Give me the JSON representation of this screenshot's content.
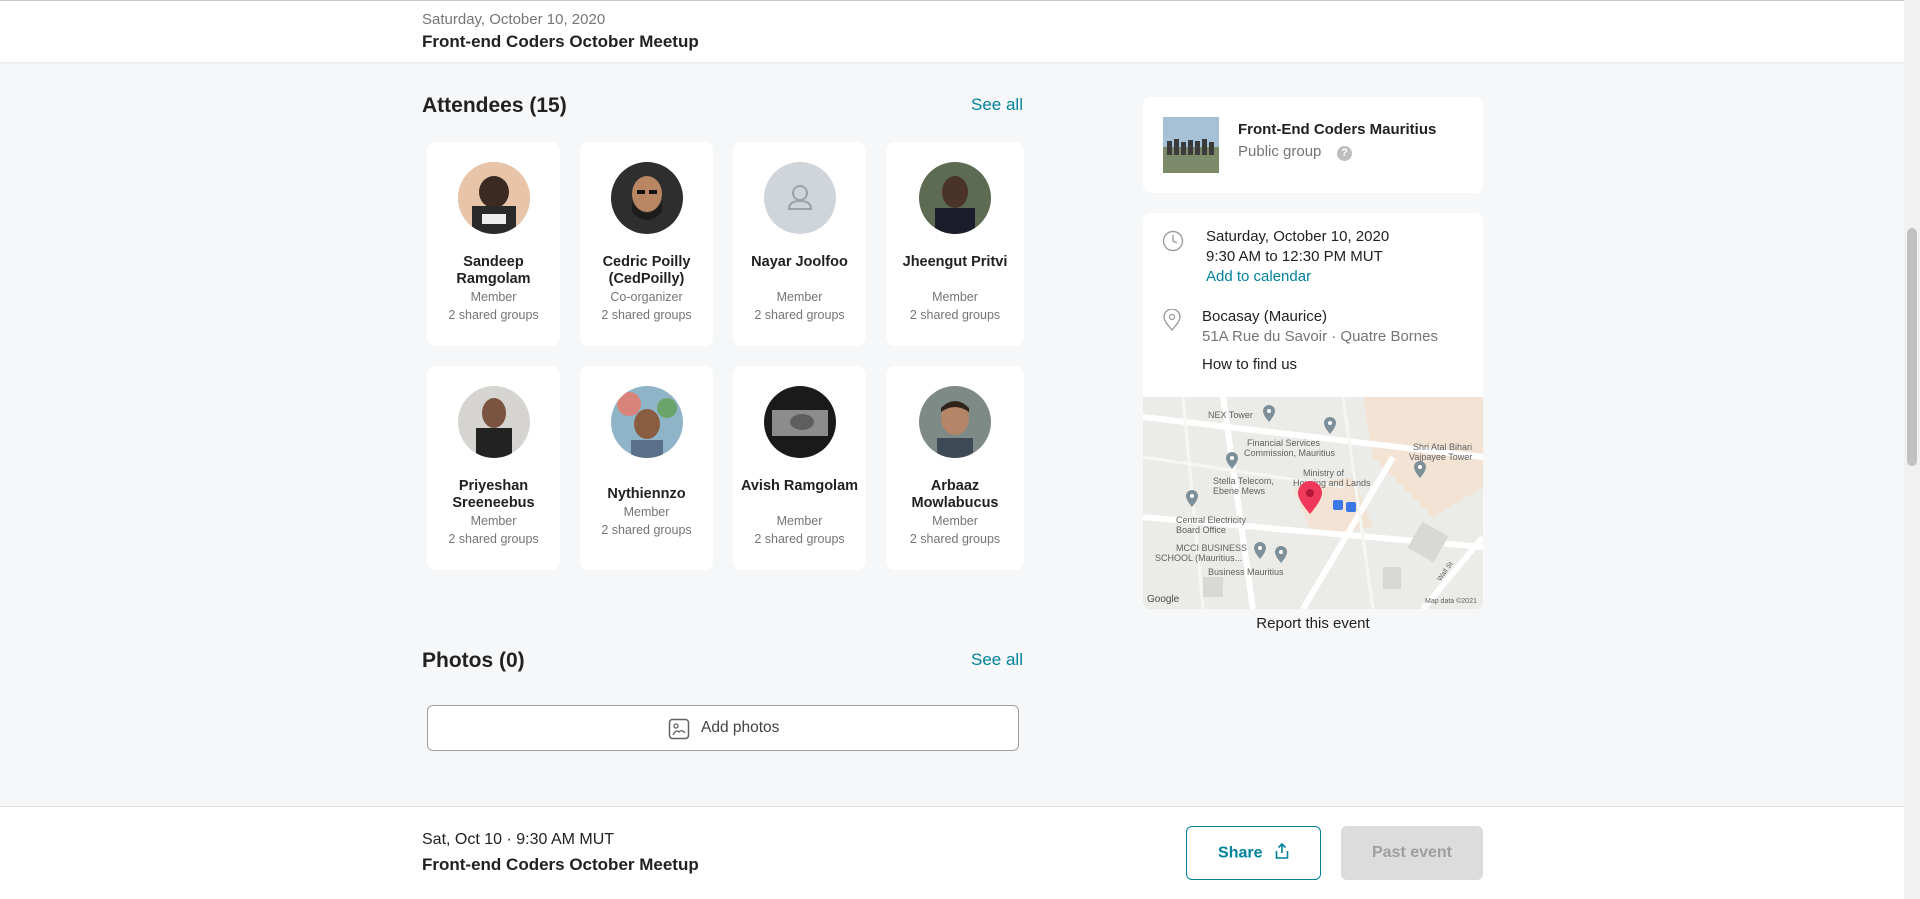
{
  "header": {
    "date": "Saturday, October 10, 2020",
    "title": "Front-end Coders October Meetup"
  },
  "attendees": {
    "title": "Attendees (15)",
    "see_all": "See all",
    "people": [
      {
        "name": "Sandeep Ramgolam",
        "role": "Member",
        "shared": "2 shared groups"
      },
      {
        "name": "Cedric Poilly (CedPoilly)",
        "role": "Co-organizer",
        "shared": "2 shared groups"
      },
      {
        "name": "Nayar Joolfoo",
        "role": "Member",
        "shared": "2 shared groups"
      },
      {
        "name": "Jheengut Pritvi",
        "role": "Member",
        "shared": "2 shared groups"
      },
      {
        "name": "Priyeshan Sreeneebus",
        "role": "Member",
        "shared": "2 shared groups"
      },
      {
        "name": "Nythiennzo",
        "role": "Member",
        "shared": "2 shared groups"
      },
      {
        "name": "Avish Ramgolam",
        "role": "Member",
        "shared": "2 shared groups"
      },
      {
        "name": "Arbaaz Mowlabucus",
        "role": "Member",
        "shared": "2 shared groups"
      }
    ]
  },
  "photos": {
    "title": "Photos (0)",
    "see_all": "See all",
    "add_label": "Add photos"
  },
  "group": {
    "name": "Front-End Coders Mauritius",
    "type": "Public group",
    "help": "?"
  },
  "event_info": {
    "date": "Saturday, October 10, 2020",
    "time": "9:30 AM to 12:30 PM MUT",
    "add_calendar": "Add to calendar",
    "venue": "Bocasay (Maurice)",
    "address": "51A Rue du Savoir · Quatre Bornes",
    "how_to_find": "How to find us"
  },
  "map": {
    "labels": {
      "nex": "NEX Tower",
      "fsc1": "Financial Services",
      "fsc2": "Commission, Mauritius",
      "shri1": "Shri Atal Bihari",
      "shri2": "Vajpayee Tower",
      "min1": "Ministry of",
      "min2": "Housing and Lands",
      "stella1": "Stella Telecom,",
      "stella2": "Ebene Mews",
      "ceb1": "Central Electricity",
      "ceb2": "Board Office",
      "mcci1": "MCCI BUSINESS",
      "mcci2": "SCHOOL (Mauritius...",
      "bm": "Business Mauritius",
      "wall": "Wall St",
      "google": "Google",
      "copyright": "Map data ©2021"
    }
  },
  "report": "Report this event",
  "footer": {
    "date": "Sat, Oct 10 · 9:30 AM MUT",
    "title": "Front-end Coders October Meetup",
    "share": "Share",
    "past": "Past event"
  },
  "colors": {
    "accent": "#00829b",
    "pin": "#f0385b"
  }
}
